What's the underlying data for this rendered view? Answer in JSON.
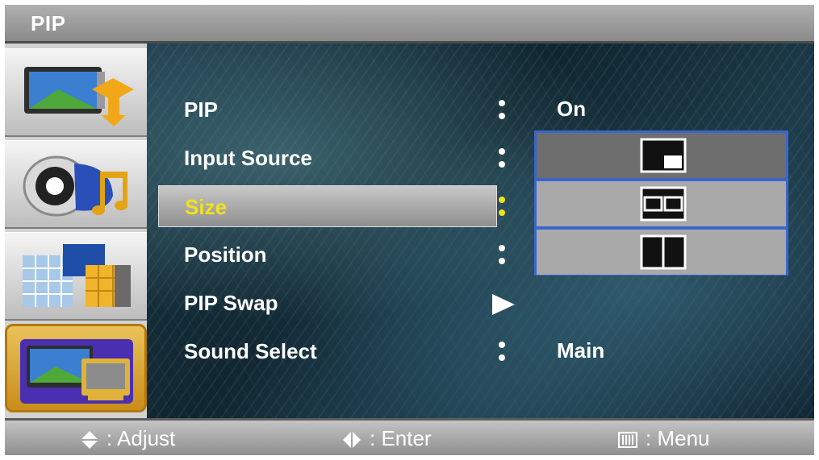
{
  "window": {
    "title": "PIP"
  },
  "sidebar": {
    "items": [
      {
        "icon": "picture-icon",
        "active": false
      },
      {
        "icon": "sound-icon",
        "active": false
      },
      {
        "icon": "channel-icon",
        "active": false
      },
      {
        "icon": "setup-icon",
        "active": true
      }
    ]
  },
  "menu": {
    "items": [
      {
        "label": "PIP",
        "value": "On",
        "selected": false
      },
      {
        "label": "Input Source",
        "value": "",
        "selected": false
      },
      {
        "label": "Size",
        "value": "",
        "selected": true
      },
      {
        "label": "Position",
        "value": "",
        "selected": false
      },
      {
        "label": "PIP Swap",
        "value": "",
        "selected": false
      },
      {
        "label": "Sound Select",
        "value": "Main",
        "selected": false
      }
    ],
    "selected_color": "#f2e21a"
  },
  "size_dropdown": {
    "options": [
      {
        "icon": "pip-small-inset-icon",
        "current": true
      },
      {
        "icon": "pip-split-double-icon",
        "current": false
      },
      {
        "icon": "pip-side-by-side-icon",
        "current": false
      }
    ],
    "border_color": "#3b66c9"
  },
  "footer": {
    "adjust_label": ": Adjust",
    "enter_label": ":  Enter",
    "menu_label": ":  Menu"
  }
}
